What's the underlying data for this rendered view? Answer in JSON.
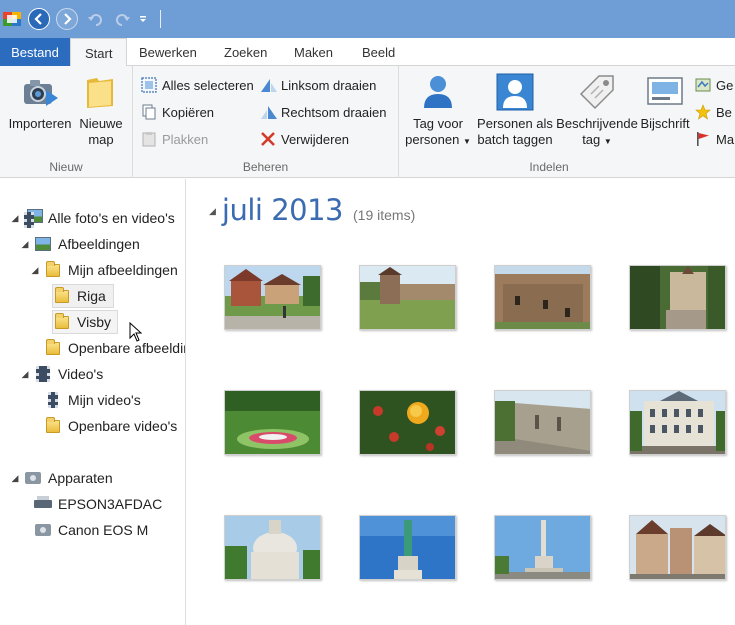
{
  "qat": {
    "app_icon": "photo-gallery-app-icon",
    "back_icon": "back-arrow-icon",
    "forward_icon": "forward-arrow-icon",
    "undo_icon": "undo-icon",
    "redo_icon": "redo-icon",
    "dropdown_icon": "chevron-down-icon"
  },
  "tabs": {
    "file": "Bestand",
    "start": "Start",
    "edit": "Bewerken",
    "search": "Zoeken",
    "create": "Maken",
    "view": "Beeld"
  },
  "ribbon": {
    "new_group": {
      "label": "Nieuw",
      "import": "Importeren",
      "new_folder_line1": "Nieuwe",
      "new_folder_line2": "map"
    },
    "manage_group": {
      "label": "Beheren",
      "select_all": "Alles selecteren",
      "copy": "Kopiëren",
      "paste": "Plakken",
      "rotate_left": "Linksom draaien",
      "rotate_right": "Rechtsom draaien",
      "delete": "Verwijderen"
    },
    "organize_group": {
      "label": "Indelen",
      "tag_people_line1": "Tag voor",
      "tag_people_line2": "personen",
      "batch_tag_line1": "Personen als",
      "batch_tag_line2": "batch taggen",
      "descriptive_tag_line1": "Beschrijvende",
      "descriptive_tag_line2": "tag",
      "caption": "Bijschrift",
      "geo_partial": "Ge",
      "rate_partial": "Be",
      "flag_partial": "Ma"
    }
  },
  "nav": {
    "all": "Alle foto's en video's",
    "pictures": "Afbeeldingen",
    "my_pictures": "Mijn afbeeldingen",
    "riga": "Riga",
    "visby": "Visby",
    "public_pictures": "Openbare afbeeldingen",
    "videos": "Video's",
    "my_videos": "Mijn video's",
    "public_videos": "Openbare video's",
    "devices": "Apparaten",
    "printer": "EPSON3AFDAC",
    "camera": "Canon EOS M"
  },
  "main": {
    "date_title": "juli 2013",
    "item_count": "(19 items)"
  },
  "colors": {
    "accent_blue": "#2b6cbf",
    "titlebar": "#6f9ed6",
    "date_title": "#3b6bb0"
  }
}
